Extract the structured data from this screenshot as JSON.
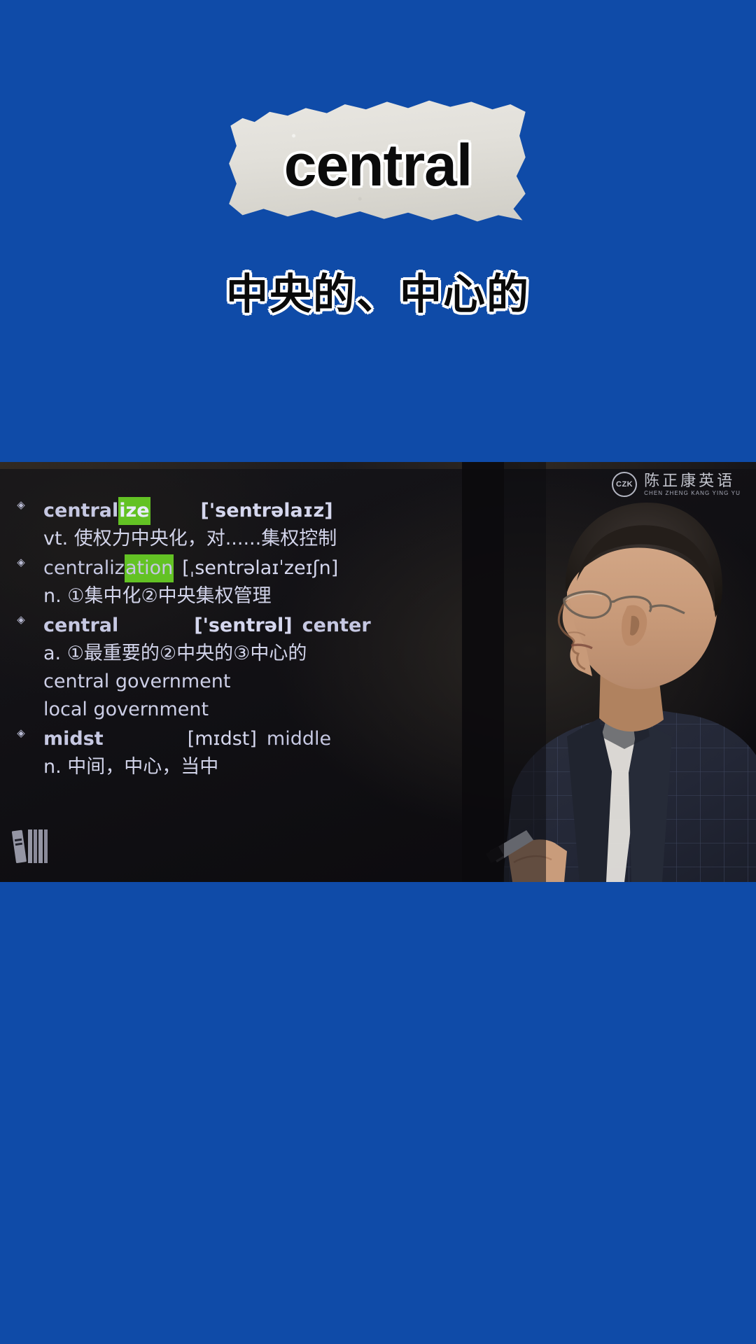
{
  "background_color": "#0F4BA8",
  "flashcard": {
    "headword": "central",
    "translation": "中央的、中心的"
  },
  "video": {
    "watermark": {
      "badge": "CZK",
      "brand_cn": "陈正康英语",
      "brand_en": "CHEN ZHENG KANG YING YU"
    },
    "corner_icon": "books-icon",
    "highlight_color": "#63C224",
    "slide": {
      "entries": [
        {
          "bullet": "◈",
          "term_prefix": "central",
          "term_highlight": "ize",
          "term_suffix": "",
          "ipa": "['sentrəlaɪz]",
          "synonym": "",
          "definition": "vt. 使权力中央化，对......集权控制",
          "examples": []
        },
        {
          "bullet": "◈",
          "term_prefix": "centraliz",
          "term_highlight": "ation",
          "term_suffix": "",
          "ipa": "[ˌsentrəlaɪˈzeɪʃn]",
          "synonym": "",
          "definition": "n. ①集中化②中央集权管理",
          "examples": []
        },
        {
          "bullet": "◈",
          "term_prefix": "central",
          "term_highlight": "",
          "term_suffix": "",
          "ipa": "['sentrəl]",
          "synonym": "center",
          "definition": "a. ①最重要的②中央的③中心的",
          "examples": [
            "central government",
            "local government"
          ]
        },
        {
          "bullet": "◈",
          "term_prefix": "midst",
          "term_highlight": "",
          "term_suffix": "",
          "ipa": "[mɪdst]",
          "synonym": "middle",
          "definition": "n. 中间，中心，当中",
          "examples": []
        }
      ]
    }
  }
}
